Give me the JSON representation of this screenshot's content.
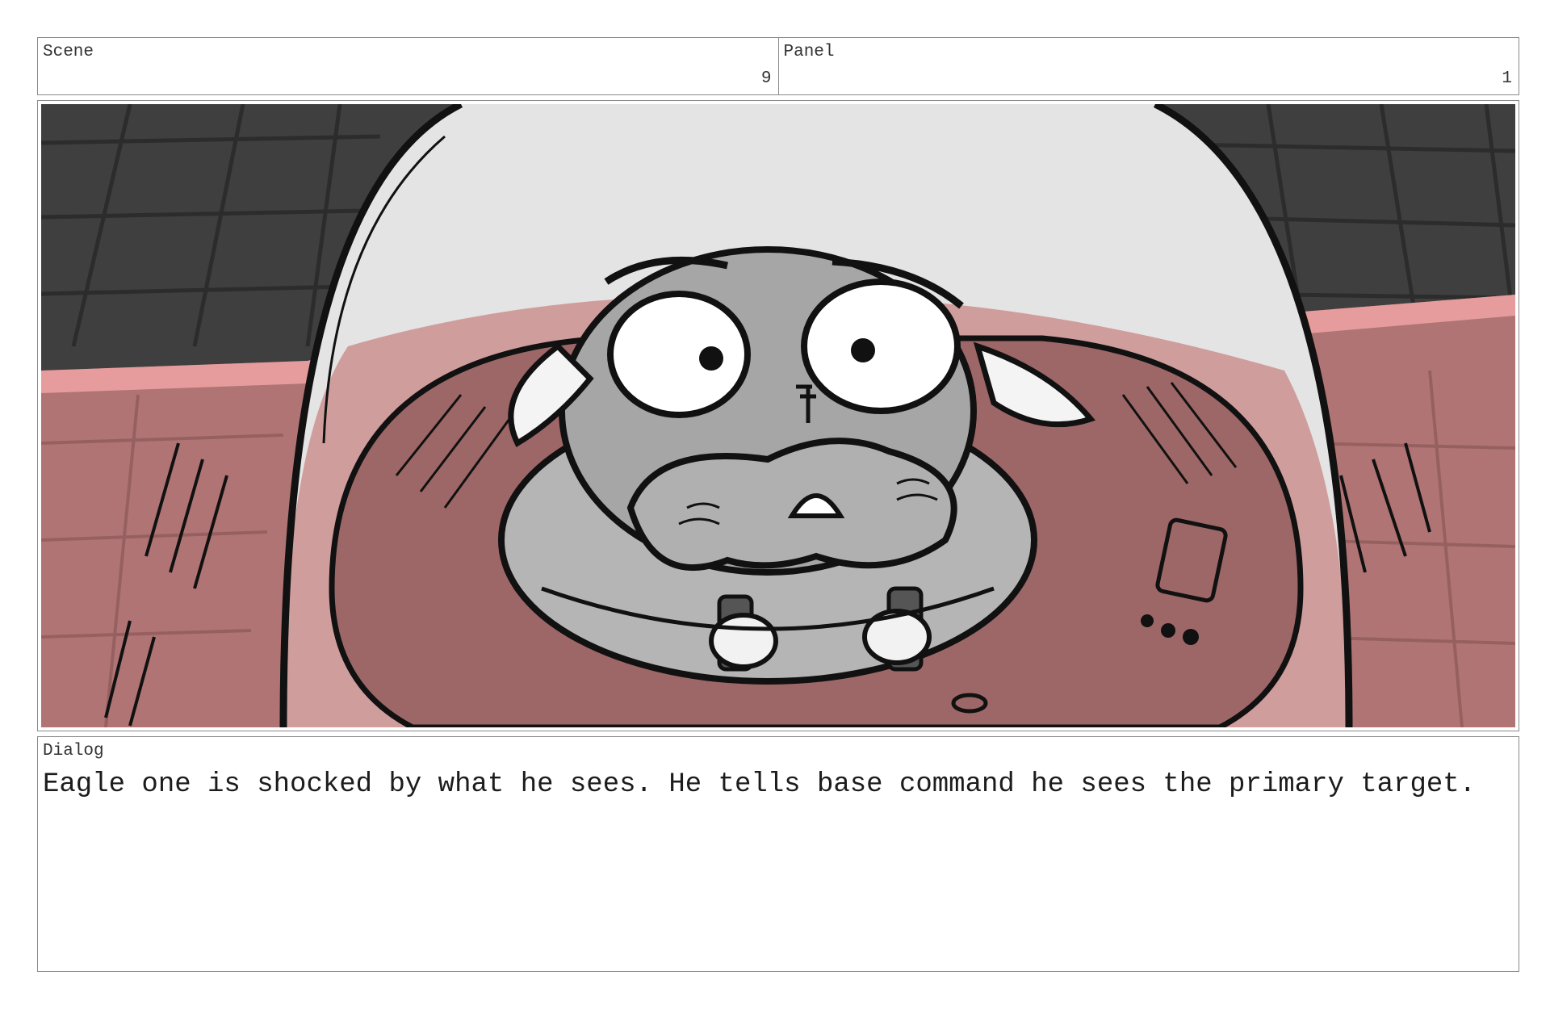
{
  "header": {
    "scene_label": "Scene",
    "scene_value": "9",
    "panel_label": "Panel",
    "panel_value": "1"
  },
  "artwork": {
    "subject": "sketch of a wide-eyed pug pilot inside a glass cockpit dome, holding two control sticks",
    "colors": {
      "background_dark": "#3f3f3f",
      "dome_sky": "#e4e4e4",
      "hull_red": "#b07474",
      "hull_highlight": "#f0a3a3",
      "pug_gray": "#a6a6a6",
      "ink": "#111111"
    }
  },
  "dialog": {
    "label": "Dialog",
    "text": "Eagle one is shocked by what he sees. He tells base command he sees the primary target."
  }
}
